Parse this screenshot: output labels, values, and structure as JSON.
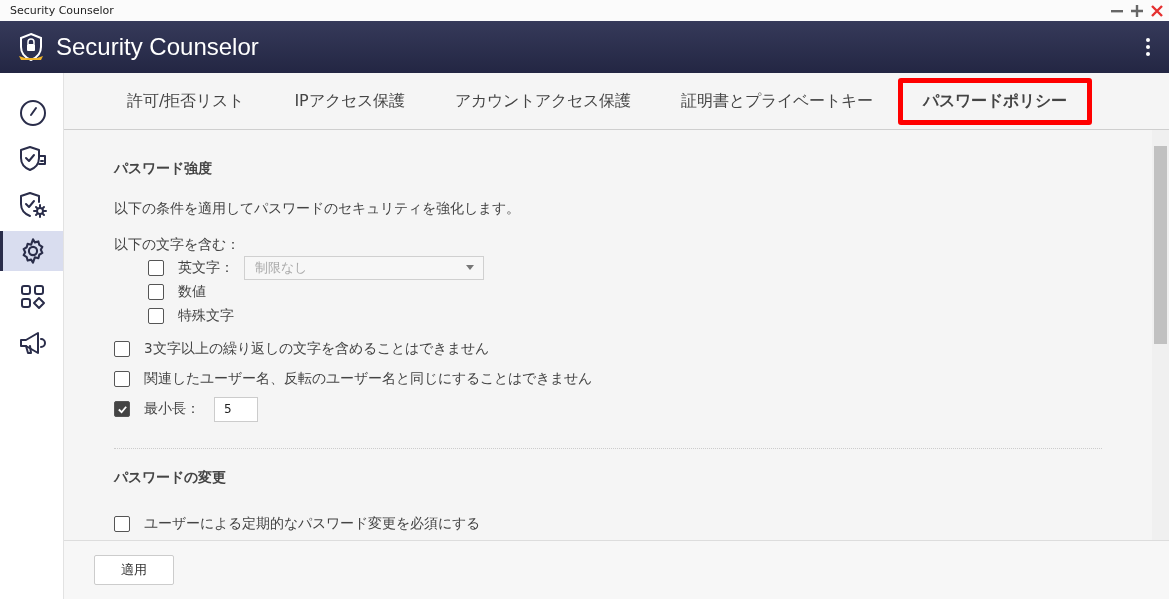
{
  "window": {
    "title": "Security Counselor"
  },
  "app": {
    "title": "Security Counselor"
  },
  "sidebar": {
    "items": [
      {
        "kind": "gauge",
        "selected": false
      },
      {
        "kind": "shield-card",
        "selected": false
      },
      {
        "kind": "shield-gear",
        "selected": false
      },
      {
        "kind": "gear",
        "selected": true
      },
      {
        "kind": "apps",
        "selected": false
      },
      {
        "kind": "megaphone",
        "selected": false
      }
    ]
  },
  "tabs": [
    {
      "label": "許可/拒否リスト",
      "selected": false
    },
    {
      "label": "IPアクセス保護",
      "selected": false
    },
    {
      "label": "アカウントアクセス保護",
      "selected": false
    },
    {
      "label": "証明書とプライベートキー",
      "selected": false
    },
    {
      "label": "パスワードポリシー",
      "selected": true
    }
  ],
  "strength": {
    "title": "パスワード強度",
    "description": "以下の条件を適用してパスワードのセキュリティを強化します。",
    "include_label": "以下の文字を含む：",
    "char_options": [
      {
        "label": "英文字：",
        "checked": false,
        "dropdown": {
          "value": "制限なし",
          "disabled": true
        }
      },
      {
        "label": "数値",
        "checked": false
      },
      {
        "label": "特殊文字",
        "checked": false
      }
    ],
    "rules": [
      {
        "kind": "checkbox",
        "label": "3文字以上の繰り返しの文字を含めることはできません",
        "checked": false
      },
      {
        "kind": "checkbox",
        "label": "関連したユーザー名、反転のユーザー名と同じにすることはできません",
        "checked": false
      },
      {
        "kind": "number",
        "label": "最小長：",
        "checked": true,
        "value": "5"
      }
    ]
  },
  "change": {
    "title": "パスワードの変更",
    "rules": [
      {
        "kind": "checkbox",
        "label": "ユーザーによる定期的なパスワード変更を必須にする",
        "checked": false
      }
    ]
  },
  "footer": {
    "apply": "適用"
  }
}
